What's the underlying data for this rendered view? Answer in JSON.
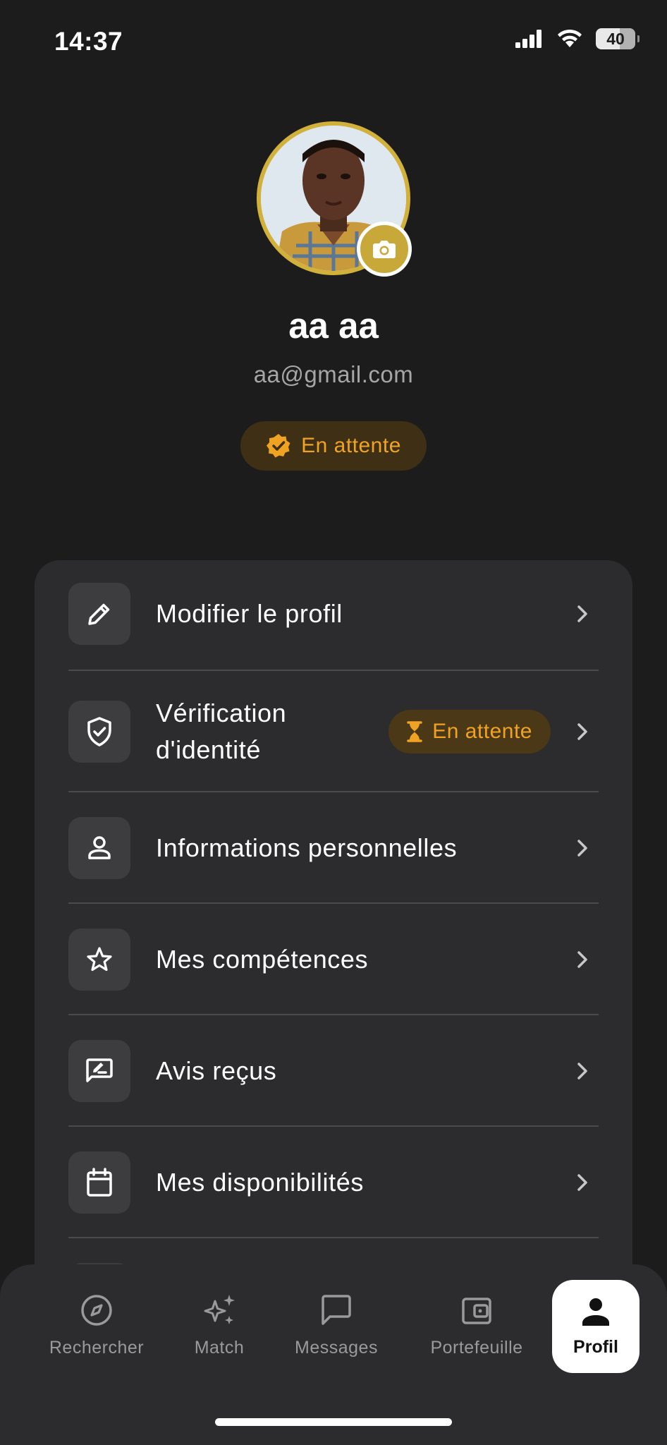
{
  "status_bar": {
    "time": "14:37",
    "battery": "40",
    "icons": [
      "signal-icon",
      "wifi-icon",
      "battery-icon"
    ]
  },
  "profile": {
    "name": "aa aa",
    "email": "aa@gmail.com",
    "status_label": "En attente",
    "status_icon": "verified-badge-icon",
    "avatar_icon": "avatar-photo",
    "camera_icon": "camera-icon"
  },
  "menu": {
    "items": [
      {
        "label": "Modifier le profil",
        "icon": "pencil-icon"
      },
      {
        "label": "Vérification d'identité",
        "label_line1": "Vérification",
        "label_line2": "d'identité",
        "icon": "shield-check-icon",
        "badge": "En attente",
        "badge_icon": "hourglass-icon"
      },
      {
        "label": "Informations personnelles",
        "icon": "person-icon"
      },
      {
        "label": "Mes compétences",
        "icon": "star-icon"
      },
      {
        "label": "Avis reçus",
        "icon": "review-icon"
      },
      {
        "label": "Mes disponibilités",
        "icon": "calendar-icon"
      }
    ]
  },
  "bottom_nav": {
    "items": [
      {
        "label": "Rechercher",
        "icon": "compass-icon"
      },
      {
        "label": "Match",
        "icon": "sparkles-icon"
      },
      {
        "label": "Messages",
        "icon": "chat-icon"
      },
      {
        "label": "Portefeuille",
        "icon": "wallet-icon"
      },
      {
        "label": "Profil",
        "icon": "person-filled-icon",
        "active": true
      }
    ]
  },
  "colors": {
    "background": "#1c1c1d",
    "card": "#2c2c2e",
    "accent_gold": "#d2b13a",
    "pending_orange": "#f0a323",
    "muted_text": "#a6a6a6"
  }
}
